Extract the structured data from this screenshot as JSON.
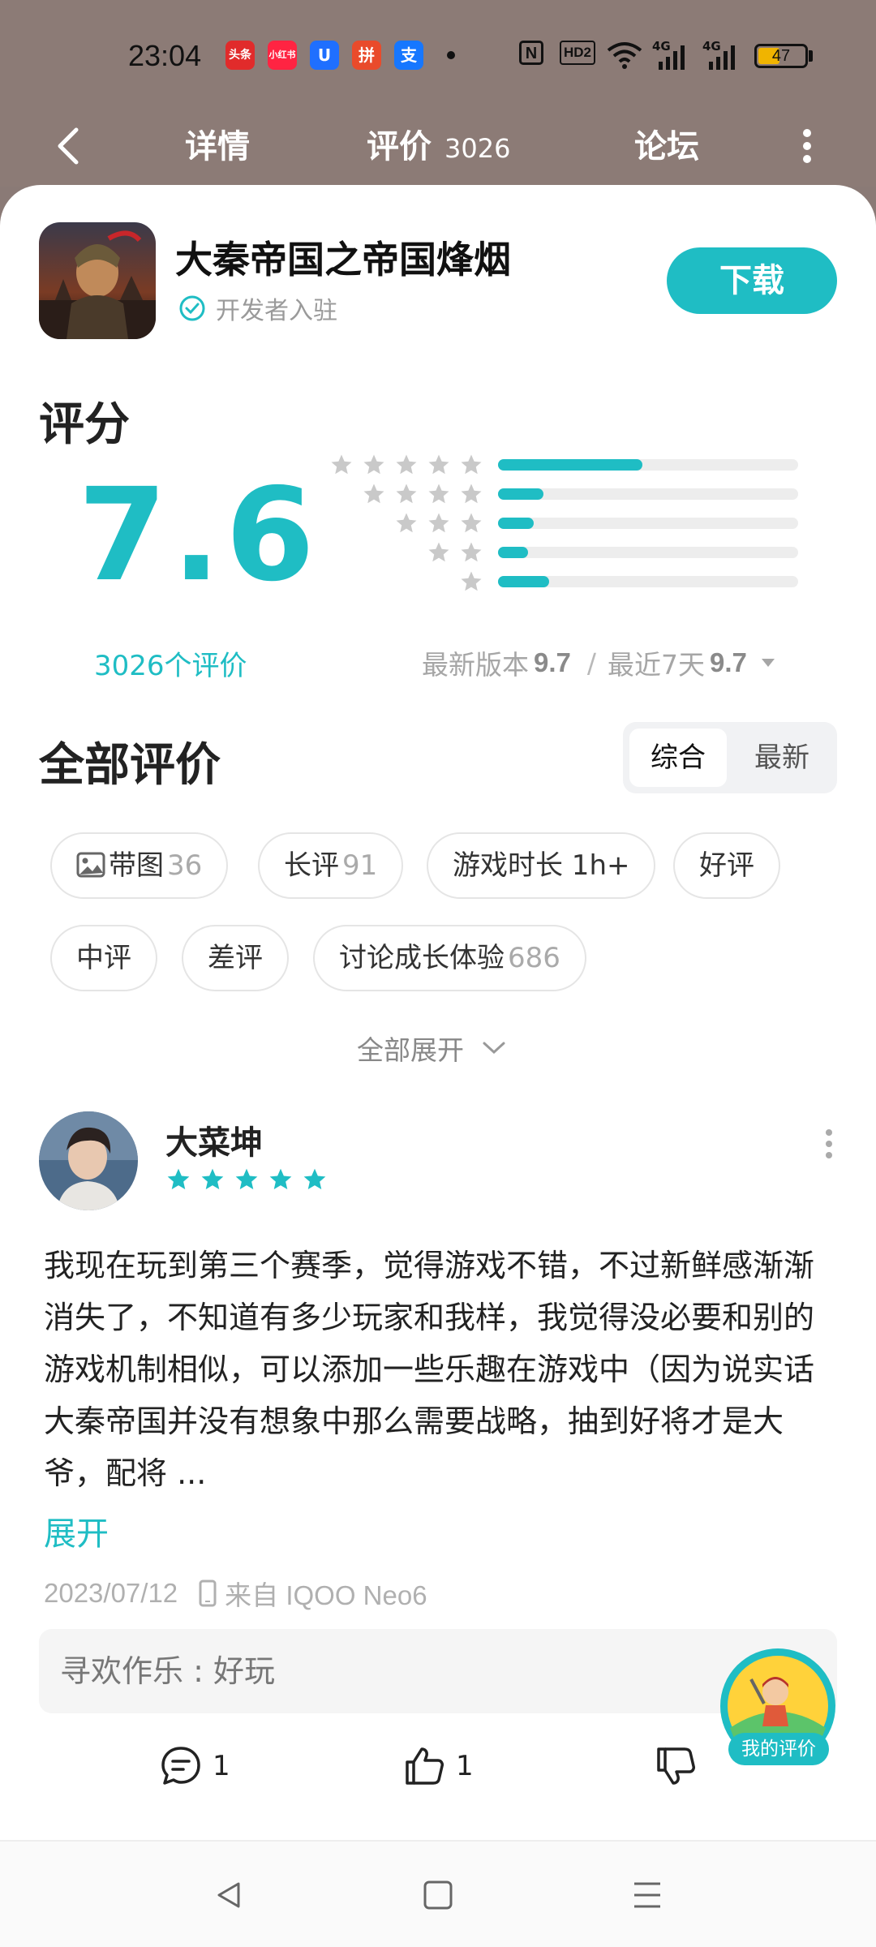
{
  "status_bar": {
    "time": "23:04",
    "apps": [
      "头条",
      "小红书",
      "U",
      "拼",
      "支"
    ],
    "network": [
      "N",
      "HD2",
      "4G",
      "4G"
    ],
    "battery": "47",
    "battery_level": 0.47
  },
  "nav": {
    "tabs": [
      {
        "label": "详情"
      },
      {
        "label": "评价",
        "count": "3026"
      },
      {
        "label": "论坛"
      }
    ]
  },
  "app": {
    "name": "大秦帝国之帝国烽烟",
    "developer_badge": "开发者入驻",
    "download_label": "下载"
  },
  "rating": {
    "title": "评分",
    "score": "7.6",
    "count_text": "3026个评价",
    "distribution": [
      {
        "stars": 5,
        "fraction": 0.48
      },
      {
        "stars": 4,
        "fraction": 0.15
      },
      {
        "stars": 3,
        "fraction": 0.12
      },
      {
        "stars": 2,
        "fraction": 0.1
      },
      {
        "stars": 1,
        "fraction": 0.17
      }
    ],
    "latest_version_label": "最新版本",
    "latest_version_score": "9.7",
    "separator": "/",
    "recent_label": "最近7天",
    "recent_score": "9.7"
  },
  "reviews_section": {
    "title": "全部评价",
    "sort": {
      "comprehensive": "综合",
      "latest": "最新",
      "active": "comprehensive"
    },
    "chips": [
      {
        "label": "带图",
        "count": "36"
      },
      {
        "label": "长评",
        "count": "91"
      },
      {
        "label": "游戏时长 1h+",
        "count": ""
      },
      {
        "label": "好评",
        "count": ""
      },
      {
        "label": "中评",
        "count": ""
      },
      {
        "label": "差评",
        "count": ""
      },
      {
        "label": "讨论成长体验",
        "count": "686"
      }
    ],
    "expand_all": "全部展开"
  },
  "review": {
    "user": "大菜坤",
    "rating": 5,
    "text": "我现在玩到第三个赛季，觉得游戏不错，不过新鲜感渐渐消失了，不知道有多少玩家和我样，我觉得没必要和别的游戏机制相似，可以添加一些乐趣在游戏中（因为说实话大秦帝国并没有想象中那么需要战略，抽到好将才是大爷，配将 ...",
    "expand": "展开",
    "date": "2023/07/12",
    "device": "来自 IQOO Neo6",
    "reply_user": "寻欢作乐",
    "reply_sep": " : ",
    "reply_text": "好玩",
    "comment_count": "1",
    "like_count": "1"
  },
  "floating": {
    "my_review": "我的评价"
  },
  "colors": {
    "accent": "#1fbdc4",
    "header_bg": "#8c7b76"
  }
}
